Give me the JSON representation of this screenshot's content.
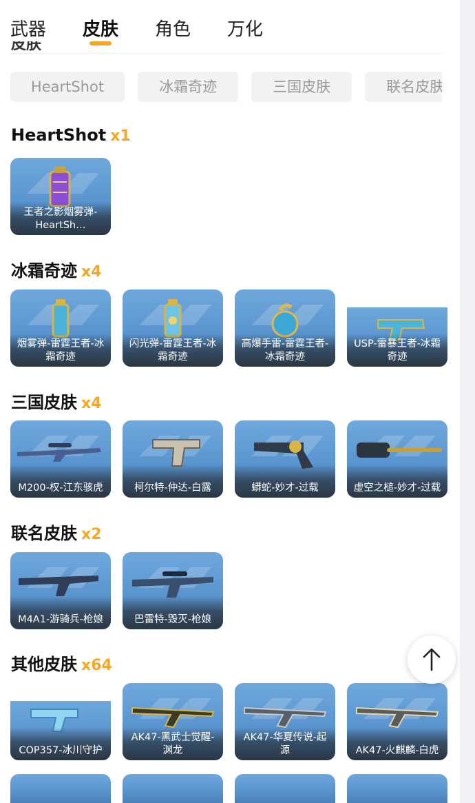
{
  "tabs": [
    {
      "label": "武器",
      "active": false
    },
    {
      "label": "皮肤",
      "active": true
    },
    {
      "label": "角色",
      "active": false
    },
    {
      "label": "万化",
      "active": false
    }
  ],
  "clipped_heading": "皮肤",
  "filter_chips": [
    "HeartShot",
    "冰霜奇迹",
    "三国皮肤",
    "联名皮肤"
  ],
  "sections": [
    {
      "title": "HeartShot",
      "count": "x1",
      "items": [
        {
          "name": "王者之影烟雾弹-HeartSh…",
          "icon": "grenade-purple-icon"
        }
      ]
    },
    {
      "title": "冰霜奇迹",
      "count": "x4",
      "items": [
        {
          "name": "烟雾弹-雷霆王者-冰霜奇迹",
          "icon": "smoke-grenade-icon"
        },
        {
          "name": "闪光弹-雷霆王者-冰霜奇迹",
          "icon": "flash-grenade-icon"
        },
        {
          "name": "高爆手雷-雷霆王者-冰霜奇迹",
          "icon": "frag-grenade-icon"
        },
        {
          "name": "USP-雷暴王者-冰霜奇迹",
          "icon": "pistol-icon"
        }
      ]
    },
    {
      "title": "三国皮肤",
      "count": "x4",
      "items": [
        {
          "name": "M200-权-江东骇虎",
          "icon": "sniper-rifle-icon"
        },
        {
          "name": "柯尔特-仲达-白露",
          "icon": "colt-pistol-icon"
        },
        {
          "name": "蟒蛇-妙才-过载",
          "icon": "revolver-icon"
        },
        {
          "name": "虚空之槌-妙才-过载",
          "icon": "hammer-icon"
        }
      ]
    },
    {
      "title": "联名皮肤",
      "count": "x2",
      "items": [
        {
          "name": "M4A1-游骑兵-枪娘",
          "icon": "assault-rifle-icon"
        },
        {
          "name": "巴雷特-毁灭-枪娘",
          "icon": "barrett-rifle-icon"
        }
      ]
    },
    {
      "title": "其他皮肤",
      "count": "x64",
      "items": [
        {
          "name": "COP357-冰川守护",
          "icon": "cop357-pistol-icon"
        },
        {
          "name": "AK47-黑武士觉醒-渊龙",
          "icon": "ak47-icon"
        },
        {
          "name": "AK47-华夏传说-起源",
          "icon": "ak47-icon"
        },
        {
          "name": "AK47-火麒麟-白虎",
          "icon": "ak47-icon"
        }
      ]
    }
  ],
  "colors": {
    "accent": "#f5a623",
    "card_bg": "#5a95d0"
  },
  "scroll_top_icon": "arrow-up-icon"
}
